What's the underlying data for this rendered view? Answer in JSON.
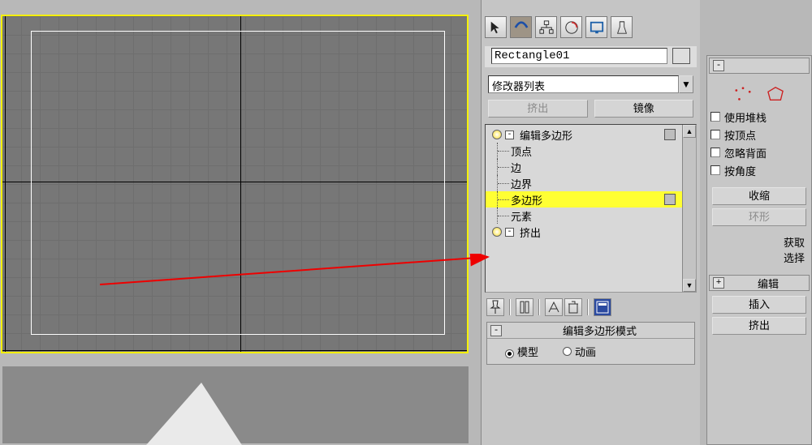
{
  "object_name": "Rectangle01",
  "modifier_combo": "修改器列表",
  "buttons": {
    "extrude": "挤出",
    "mirror": "镜像"
  },
  "stack": {
    "edit_poly": "编辑多边形",
    "subs": [
      "顶点",
      "边",
      "边界",
      "多边形",
      "元素"
    ],
    "extrude_mod": "挤出"
  },
  "rollout": {
    "title": "编辑多边形模式",
    "model": "模型",
    "anim": "动画"
  },
  "right": {
    "use_stack": "使用堆栈",
    "by_vertex": "按顶点",
    "ignore_back": "忽略背面",
    "by_angle": "按角度",
    "shrink": "收缩",
    "ring": "环形",
    "get": "获取",
    "sel": "选择",
    "edit": "编辑",
    "insert": "插入",
    "extrude2": "挤出"
  }
}
